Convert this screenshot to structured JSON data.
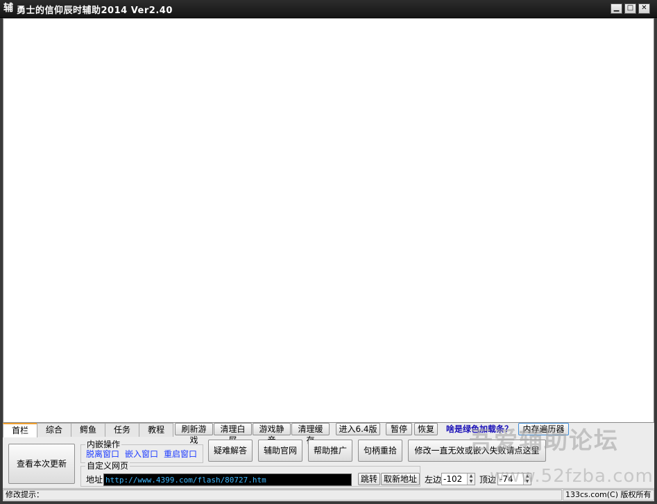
{
  "window": {
    "icon_char": "辅",
    "title": "勇士的信仰辰时辅助2014 Ver2.40",
    "min_label": "▁",
    "max_label": "□",
    "close_label": "✕"
  },
  "tabs": [
    {
      "label": "首栏",
      "active": true
    },
    {
      "label": "综合"
    },
    {
      "label": "鳄鱼"
    },
    {
      "label": "任务"
    },
    {
      "label": "教程"
    }
  ],
  "toolbar": {
    "refresh_game": "刷新游戏",
    "clear_white": "清理白屏",
    "mute_game": "游戏静音",
    "clear_cache": "清理缓存",
    "enter_64": "进入6.4版",
    "pause": "暂停",
    "resume": "恢复",
    "green_bar_question": "啥是绿色加载条？",
    "memory_walker": "内存遍历器"
  },
  "main": {
    "view_update": "查看本次更新",
    "embed_group_title": "内嵌操作",
    "detach_window": "脱离窗口",
    "embed_window": "嵌入窗口",
    "restart_window": "重启窗口",
    "faq": "疑难解答",
    "official_site": "辅助官网",
    "help_promote": "帮助推广",
    "handle_reset": "句柄重拾",
    "fix_hint": "修改一直无效或嵌入失败请点这里",
    "custom_page_title": "自定义网页",
    "address_label": "地址",
    "address_value": "http://www.4399.com/flash/80727.htm",
    "jump": "跳转",
    "fetch_address": "取新地址",
    "left_label": "左边",
    "left_value": "-102",
    "top_label": "顶边",
    "top_value": "-74"
  },
  "status": {
    "hint_label": "修改提示：",
    "copyright": "133cs.com(C) 版权所有"
  },
  "watermark": {
    "line1": "吾爱辅助论坛",
    "line2": "www.52fzba.com"
  },
  "colors": {
    "titlebar": "#1e1e1e",
    "link_blue": "#1e3cff",
    "address_text": "#3fb9ff",
    "tab_accent": "#f0a030"
  },
  "icons": [
    "minimize-icon",
    "maximize-icon",
    "close-icon",
    "spin-up-icon",
    "spin-down-icon"
  ]
}
